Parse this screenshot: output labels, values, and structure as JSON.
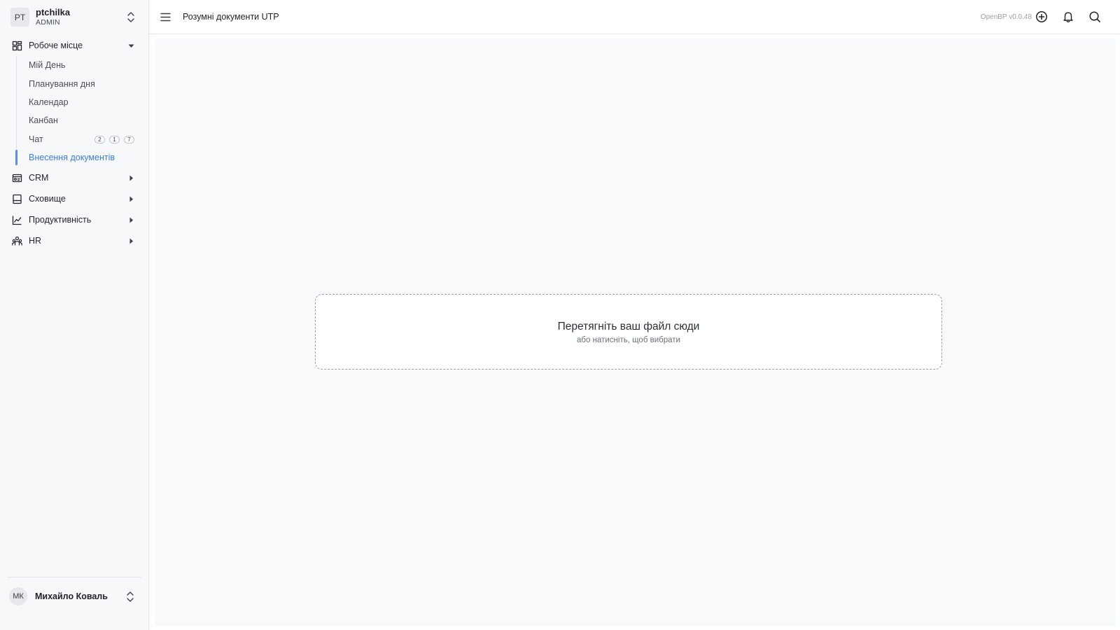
{
  "workspace": {
    "initials": "PT",
    "name": "ptchilka",
    "role": "ADMIN"
  },
  "nav": {
    "workplace": {
      "label": "Робоче місце",
      "items": [
        {
          "label": "Мій День"
        },
        {
          "label": "Планування дня"
        },
        {
          "label": "Календар"
        },
        {
          "label": "Канбан"
        },
        {
          "label": "Чат",
          "badges": [
            "2",
            "1",
            "7"
          ]
        },
        {
          "label": "Внесення документів",
          "active": true
        }
      ]
    },
    "groups": [
      {
        "label": "CRM",
        "icon": "crm-icon"
      },
      {
        "label": "Сховище",
        "icon": "storage-icon"
      },
      {
        "label": "Продуктивність",
        "icon": "chart-icon"
      },
      {
        "label": "HR",
        "icon": "people-icon"
      }
    ]
  },
  "user": {
    "initials": "МК",
    "name": "Михайло Коваль"
  },
  "header": {
    "title": "Розумні документи UTP",
    "version": "OpenBP v0.0.48"
  },
  "dropzone": {
    "title": "Перетягніть ваш файл сюди",
    "subtitle": "або натисніть, щоб вибрати"
  },
  "colors": {
    "accent": "#3b7de0",
    "active_bar": "#5b8ee6",
    "sidebar_bg": "#f7f8fa",
    "main_bg": "#f8f9fb"
  }
}
